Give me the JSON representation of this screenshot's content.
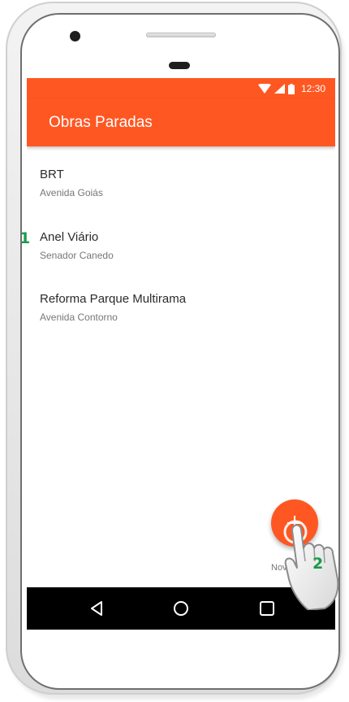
{
  "status_bar": {
    "time": "12:30",
    "icons": [
      "wifi-icon",
      "signal-icon",
      "battery-icon"
    ]
  },
  "app_bar": {
    "title": "Obras Paradas"
  },
  "list": {
    "items": [
      {
        "title": "BRT",
        "subtitle": "Avenida Goiás"
      },
      {
        "title": "Anel Viário",
        "subtitle": "Senador Canedo"
      },
      {
        "title": "Reforma Parque Multirama",
        "subtitle": "Avenida Contorno"
      }
    ]
  },
  "fab": {
    "label": "Nova",
    "icon": "plus-icon"
  },
  "nav_bar": {
    "icons": [
      "back-icon",
      "home-icon",
      "recents-icon"
    ]
  },
  "annotations": {
    "marker_1": "1",
    "marker_2": "2"
  },
  "colors": {
    "primary": "#ff5722",
    "annotation": "#1b9a4b",
    "nav_bar": "#000000"
  }
}
